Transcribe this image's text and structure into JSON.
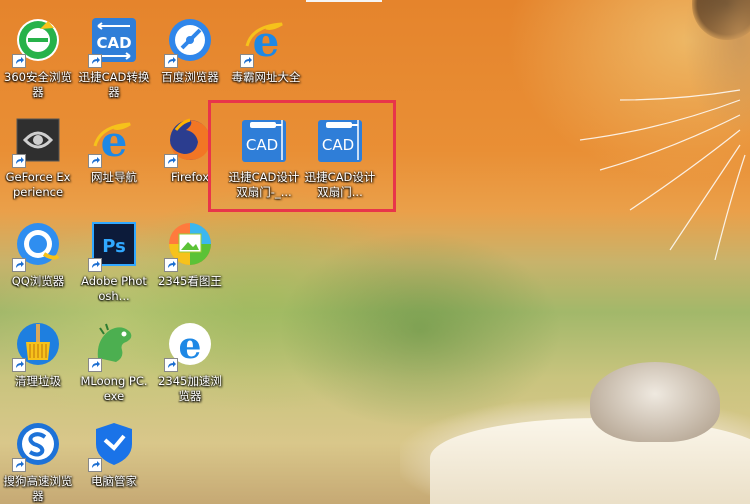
{
  "desktop": {
    "icons": [
      {
        "label": "360安全浏览器",
        "icon": "360-browser-icon"
      },
      {
        "label": "迅捷CAD转换器",
        "icon": "cad-converter-icon"
      },
      {
        "label": "百度浏览器",
        "icon": "baidu-browser-icon"
      },
      {
        "label": "毒霸网址大全",
        "icon": "ie-style-e-icon"
      },
      {
        "label": "GeForce Experience",
        "icon": "geforce-experience-icon"
      },
      {
        "label": "网址导航",
        "icon": "ie-style-e-icon"
      },
      {
        "label": "Firefox",
        "icon": "firefox-icon"
      },
      {
        "label": "迅捷CAD设计双扇门-_...",
        "icon": "cad-file-icon"
      },
      {
        "label": "迅捷CAD设计双扇门...",
        "icon": "cad-file-icon"
      },
      {
        "label": "QQ浏览器",
        "icon": "qq-browser-icon"
      },
      {
        "label": "Adobe Photosh...",
        "icon": "photoshop-icon"
      },
      {
        "label": "2345看图王",
        "icon": "2345-image-viewer-icon"
      },
      {
        "label": "清理垃圾",
        "icon": "cleanup-broom-icon"
      },
      {
        "label": "MLoong PC.exe",
        "icon": "mloong-dinosaur-icon"
      },
      {
        "label": "2345加速浏览器",
        "icon": "2345-browser-icon"
      },
      {
        "label": "搜狗高速浏览器",
        "icon": "sogou-browser-icon"
      },
      {
        "label": "电脑管家",
        "icon": "tencent-pc-manager-icon"
      }
    ],
    "cad_text": "CAD",
    "ps_text": "Ps",
    "highlight_color": "#e8354a"
  }
}
